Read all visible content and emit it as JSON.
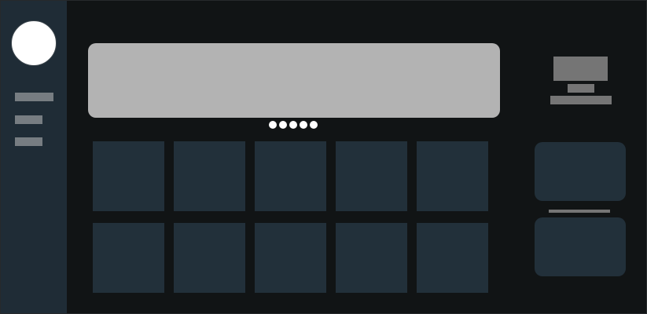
{
  "sidebar": {
    "avatar_icon": "user-avatar-icon",
    "items": [
      "",
      "",
      ""
    ]
  },
  "banner": {
    "carousel_page_count": 5
  },
  "grid": {
    "tile_count": 10
  },
  "right_panel": {
    "device_icon": "monitor-icon",
    "cards": [
      "",
      ""
    ]
  },
  "colors": {
    "background": "#111415",
    "sidebar": "#1f2c36",
    "tile": "#22303a",
    "banner": "#b3b3b3",
    "placeholder": "#777d82",
    "dot": "#ffffff"
  }
}
